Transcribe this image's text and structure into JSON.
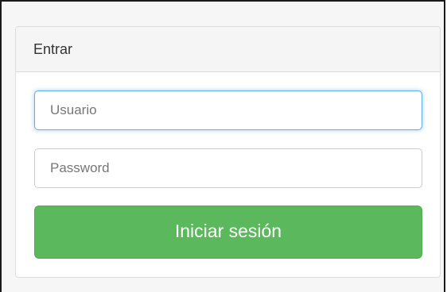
{
  "panel": {
    "title": "Entrar"
  },
  "form": {
    "username": {
      "placeholder": "Usuario",
      "value": ""
    },
    "password": {
      "placeholder": "Password",
      "value": ""
    },
    "submit_label": "Iniciar sesión"
  },
  "colors": {
    "submit_bg": "#5cb85c",
    "focus_border": "#66afe9"
  }
}
